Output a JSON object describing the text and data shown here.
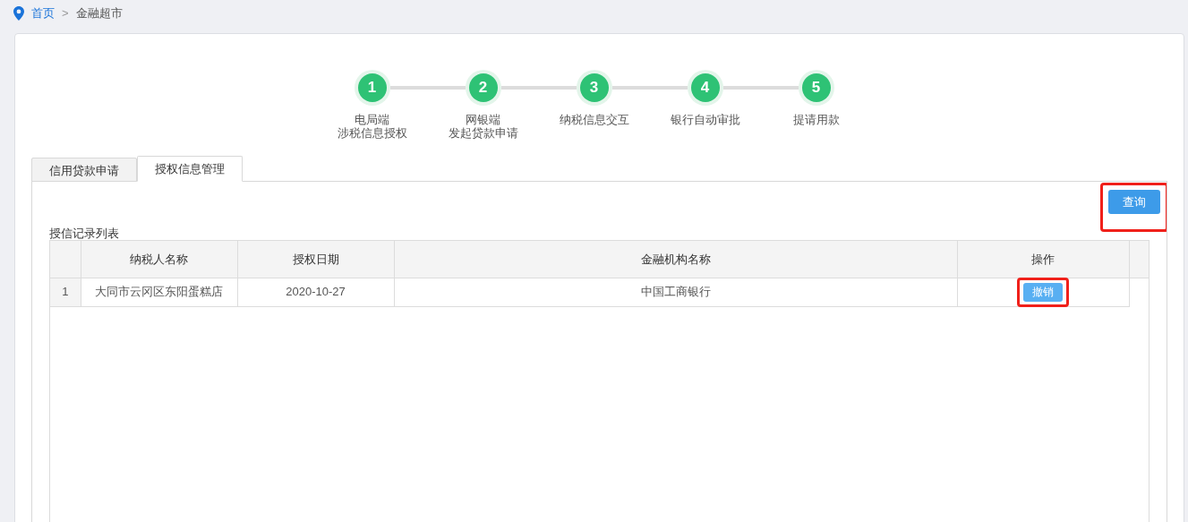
{
  "breadcrumb": [
    {
      "label": "首页",
      "kind": "link"
    },
    {
      "label": ">",
      "kind": "separator"
    },
    {
      "label": "金融超市",
      "kind": "current"
    }
  ],
  "steps": [
    {
      "number": "1",
      "lines": [
        "电局端",
        "涉税信息授权"
      ]
    },
    {
      "number": "2",
      "lines": [
        "网银端",
        "发起贷款申请"
      ]
    },
    {
      "number": "3",
      "lines": [
        "纳税信息交互"
      ]
    },
    {
      "number": "4",
      "lines": [
        "银行自动审批"
      ]
    },
    {
      "number": "5",
      "lines": [
        "提请用款"
      ]
    }
  ],
  "tabs": [
    {
      "label": "信用贷款申请",
      "selected": false
    },
    {
      "label": "授权信息管理",
      "selected": true
    }
  ],
  "query_button": {
    "label": "查询",
    "highlighted": true
  },
  "list_title": "授信记录列表",
  "table": {
    "columns": [
      "",
      "纳税人名称",
      "授权日期",
      "金融机构名称",
      "操作"
    ],
    "rows": [
      {
        "cells": [
          "1",
          "大同市云冈区东阳蛋糕店",
          "2020-10-27",
          "中国工商银行"
        ],
        "action": {
          "label": "撤销",
          "highlighted": true
        }
      }
    ]
  }
}
